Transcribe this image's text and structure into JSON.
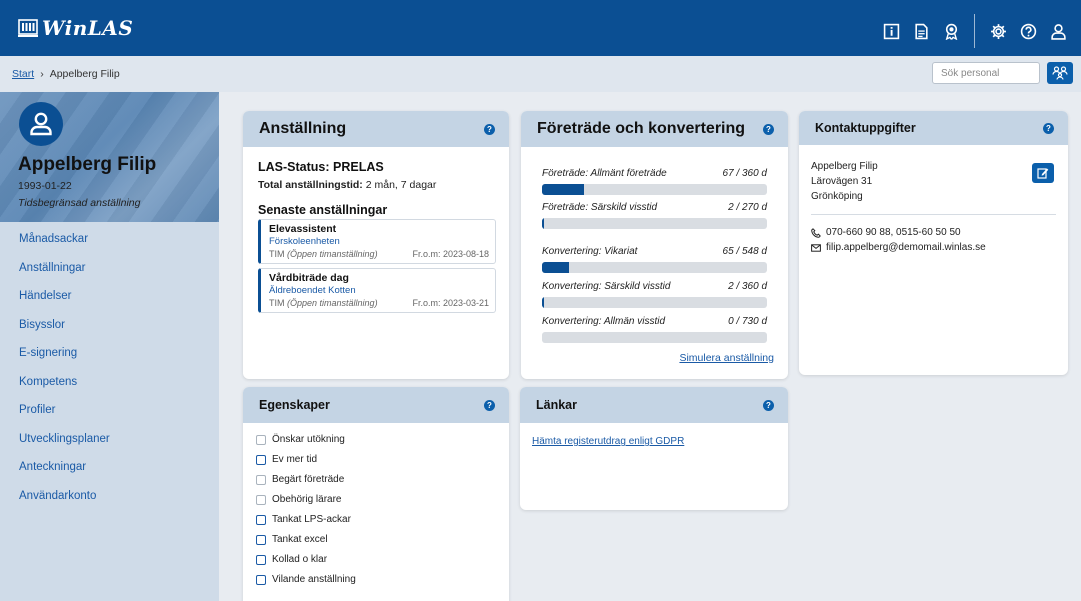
{
  "app": {
    "logo_text": "WinLAS"
  },
  "header_icons": [
    "info-icon",
    "document-icon",
    "award-icon",
    "gear-icon",
    "help-icon",
    "user-icon"
  ],
  "breadcrumb": {
    "start": "Start",
    "separator": "›",
    "current": "Appelberg Filip"
  },
  "search": {
    "placeholder": "Sök personal"
  },
  "profile": {
    "name": "Appelberg Filip",
    "dob": "1993-01-22",
    "employment_type": "Tidsbegränsad anställning"
  },
  "nav": [
    "Månadsackar",
    "Anställningar",
    "Händelser",
    "Bisysslor",
    "E-signering",
    "Kompetens",
    "Profiler",
    "Utvecklingsplaner",
    "Anteckningar",
    "Användarkonto"
  ],
  "anstallning": {
    "title": "Anställning",
    "las_status": "LAS-Status: PRELAS",
    "total_label": "Total anställningstid:",
    "total_value": "2 mån, 7 dagar",
    "recent_title": "Senaste anställningar",
    "items": [
      {
        "title": "Elevassistent",
        "place": "Förskoleenheten",
        "type": "TIM",
        "type_desc": "(Öppen timanställning)",
        "from": "Fr.o.m: 2023-08-18"
      },
      {
        "title": "Vårdbiträde dag",
        "place": "Äldreboendet Kotten",
        "type": "TIM",
        "type_desc": "(Öppen timanställning)",
        "from": "Fr.o.m: 2023-03-21"
      }
    ]
  },
  "foretrade": {
    "title": "Företräde och konvertering",
    "bars": [
      {
        "label": "Företräde: Allmänt företräde",
        "value": "67 / 360 d",
        "fraction": 0.186
      },
      {
        "label": "Företräde: Särskild visstid",
        "value": "2 / 270 d",
        "fraction": 0.007
      },
      {
        "label": "Konvertering: Vikariat",
        "value": "65 / 548 d",
        "fraction": 0.119
      },
      {
        "label": "Konvertering: Särskild visstid",
        "value": "2 / 360 d",
        "fraction": 0.006
      },
      {
        "label": "Konvertering: Allmän visstid",
        "value": "0 / 730 d",
        "fraction": 0.0
      }
    ],
    "simulate_link": "Simulera anställning"
  },
  "kontakt": {
    "title": "Kontaktuppgifter",
    "name": "Appelberg Filip",
    "street": "Lärovägen 31",
    "city": "Grönköping",
    "phone": "070-660 90 88, 0515-60 50 50",
    "email": "filip.appelberg@demomail.winlas.se"
  },
  "egenskaper": {
    "title": "Egenskaper",
    "items": [
      {
        "label": "Önskar utökning",
        "checked": false,
        "highlight": false
      },
      {
        "label": "Ev mer tid",
        "checked": false,
        "highlight": true
      },
      {
        "label": "Begärt företräde",
        "checked": false,
        "highlight": false
      },
      {
        "label": "Obehörig lärare",
        "checked": false,
        "highlight": false
      },
      {
        "label": "Tankat LPS-ackar",
        "checked": false,
        "highlight": true
      },
      {
        "label": "Tankat excel",
        "checked": false,
        "highlight": true
      },
      {
        "label": "Kollad o klar",
        "checked": false,
        "highlight": true
      },
      {
        "label": "Vilande anställning",
        "checked": false,
        "highlight": true
      }
    ]
  },
  "lankar": {
    "title": "Länkar",
    "gdpr_link": "Hämta registerutdrag enligt GDPR"
  },
  "colors": {
    "primary": "#0b4f93",
    "card_header": "#c4d4e4",
    "sidebar": "#cfdbe8",
    "link": "#1a5aa6"
  }
}
